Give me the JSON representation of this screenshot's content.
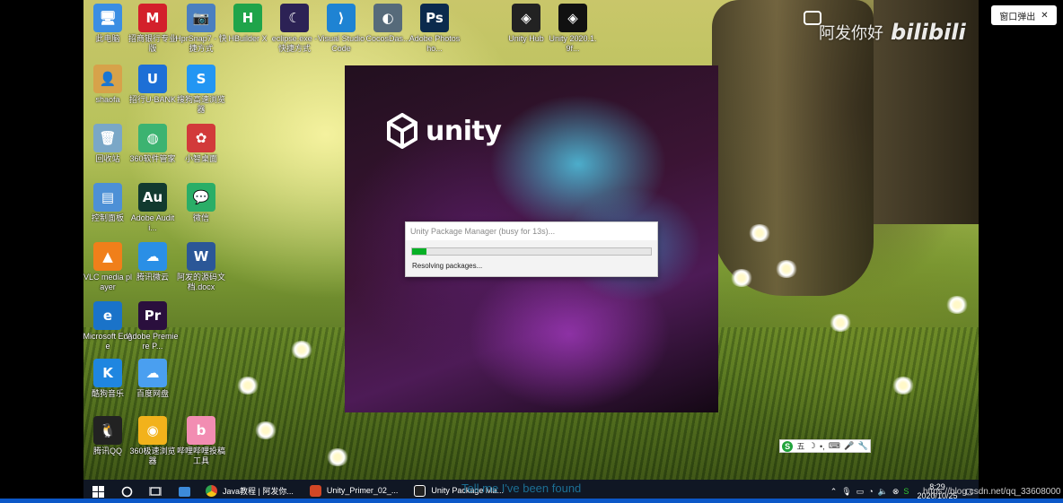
{
  "desktop_icons": [
    {
      "label": "此电脑",
      "glyph": "🖥",
      "color": "#3b8ee3"
    },
    {
      "label": "招商银行专业版",
      "glyph": "M",
      "color": "#d3202b"
    },
    {
      "label": "HprSnap7 - 快捷方式",
      "glyph": "📷",
      "color": "#4a7fc0"
    },
    {
      "label": "HBuilder X",
      "glyph": "H",
      "color": "#1fa44a"
    },
    {
      "label": "eclipse.exe - 快捷方式",
      "glyph": "☾",
      "color": "#2c2255"
    },
    {
      "label": "Visual Studio Code",
      "glyph": "⟩",
      "color": "#1e83d3"
    },
    {
      "label": "CocosDas...",
      "glyph": "◐",
      "color": "#566a7a"
    },
    {
      "label": "Adobe Photosho...",
      "glyph": "Ps",
      "color": "#0b2a4d"
    },
    {
      "label": "Unity Hub",
      "glyph": "◈",
      "color": "#222222"
    },
    {
      "label": "Unity 2020.1.9f...",
      "glyph": "◈",
      "color": "#111111"
    },
    {
      "label": "shaofa",
      "glyph": "👤",
      "color": "#d7a24a"
    },
    {
      "label": "招行U-BANK",
      "glyph": "U",
      "color": "#1d6fd6"
    },
    {
      "label": "搜狗高速浏览器",
      "glyph": "S",
      "color": "#2296f3"
    },
    {
      "label": "回收站",
      "glyph": "🗑",
      "color": "#7aa7c7"
    },
    {
      "label": "360软件管家",
      "glyph": "◍",
      "color": "#3cb371"
    },
    {
      "label": "小智桌面",
      "glyph": "✿",
      "color": "#d23a3a"
    },
    {
      "label": "控制面板",
      "glyph": "▤",
      "color": "#4d90d6"
    },
    {
      "label": "Adobe Auditi...",
      "glyph": "Au",
      "color": "#123a2f"
    },
    {
      "label": "微信",
      "glyph": "💬",
      "color": "#2aae67"
    },
    {
      "label": "VLC media player",
      "glyph": "▲",
      "color": "#f07f1a"
    },
    {
      "label": "腾讯微云",
      "glyph": "☁",
      "color": "#2a8fe6"
    },
    {
      "label": "阿发的源码文档.docx",
      "glyph": "W",
      "color": "#2b5797"
    },
    {
      "label": "Microsoft Edge",
      "glyph": "e",
      "color": "#1a73c9"
    },
    {
      "label": "Adobe Premiere P...",
      "glyph": "Pr",
      "color": "#2a0f3d"
    },
    {
      "label": "酷狗音乐",
      "glyph": "K",
      "color": "#1f86e0"
    },
    {
      "label": "百度网盘",
      "glyph": "☁",
      "color": "#4a9ff0"
    },
    {
      "label": "腾讯QQ",
      "glyph": "🐧",
      "color": "#222222"
    },
    {
      "label": "360极速浏览器",
      "glyph": "◉",
      "color": "#f2b21b"
    },
    {
      "label": "哔哩哔哩投稿工具",
      "glyph": "b",
      "color": "#f28db2"
    }
  ],
  "splash": {
    "logo_text": "unity"
  },
  "package_dialog": {
    "title": "Unity Package Manager (busy for 13s)...",
    "status": "Resolving packages...",
    "progress": 0.06
  },
  "overlay": {
    "popout_label": "窗口弹出",
    "popout_close": "✕",
    "watermark_cn": "阿发你好",
    "watermark_brand": "bilibili"
  },
  "ime": {
    "logo": "S",
    "mode": "五",
    "items": [
      "☽",
      "•,",
      "⌨",
      "🎤",
      "🔧"
    ]
  },
  "taskbar": {
    "apps": [
      {
        "label": "Java教程 | 阿发你...",
        "color": "#e0452d"
      },
      {
        "label": "Unity_Primer_02_...",
        "color": "#d24726"
      },
      {
        "label": "Unity Package Ma...",
        "color": "#222222"
      }
    ],
    "time": "8:29",
    "date": "2020/10/25",
    "subtitle": "Tell me I've been found",
    "blog_watermark": "https://blog.csdn.net/qq_33608000"
  }
}
